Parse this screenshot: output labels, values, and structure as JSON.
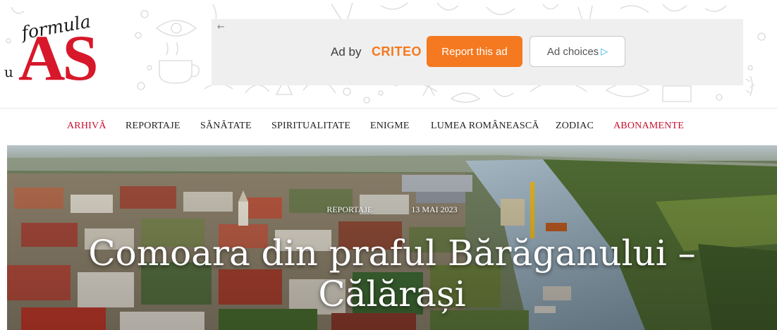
{
  "logo": {
    "prefix": "u",
    "script": "formula",
    "main": "AS"
  },
  "ad": {
    "back_icon": "back-arrow-icon",
    "by_label": "Ad by",
    "brand": "CRITEO",
    "report_label": "Report this ad",
    "choices_label": "Ad choices",
    "choices_icon": "ad-choices-icon"
  },
  "nav": {
    "items": [
      {
        "label": "ARHIVĂ"
      },
      {
        "label": "REPORTAJE"
      },
      {
        "label": "SĂNĂTATE"
      },
      {
        "label": "SPIRITUALITATE"
      },
      {
        "label": "ENIGME"
      },
      {
        "label": "LUMEA ROMÂNEASCĂ"
      },
      {
        "label": "ZODIAC"
      },
      {
        "label": "ABONAMENTE"
      }
    ]
  },
  "article": {
    "category": "REPORTAJE",
    "date": "13 MAI 2023",
    "title": "Comoara din praful Bărăganului – Călărași"
  },
  "colors": {
    "brand_red": "#d7182a",
    "nav_accent": "#c8102e",
    "criteo_orange": "#f47920",
    "ad_bg": "#f0efef"
  }
}
